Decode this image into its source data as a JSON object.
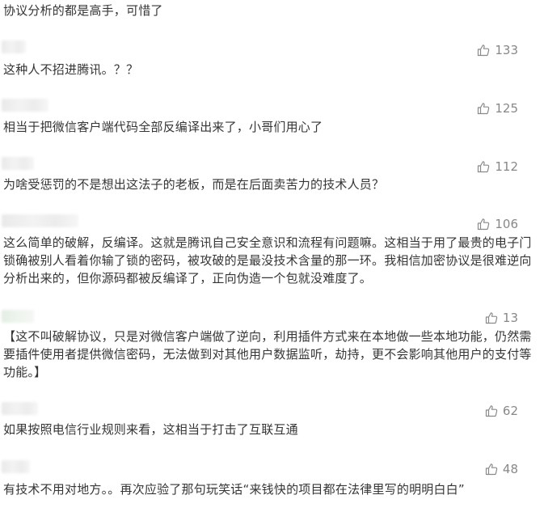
{
  "comments": [
    {
      "text": "协议分析的都是高手，可惜了",
      "likes": ""
    },
    {
      "text": "这种人不招进腾讯。？？",
      "likes": "133"
    },
    {
      "text": "相当于把微信客户端代码全部反编译出来了，小哥们用心了",
      "likes": "125"
    },
    {
      "text": "为啥受惩罚的不是想出这法子的老板，而是在后面卖苦力的技术人员？",
      "likes": "112"
    },
    {
      "text": "这么简单的破解，反编译。这就是腾讯自己安全意识和流程有问题嘛。这相当于用了最贵的电子门锁确被别人看着你输了锁的密码，被攻破的是最没技术含量的那一环。我相信加密协议是很难逆向分析出来的，但你源码都被反编译了，正向伪造一个包就没难度了。",
      "likes": "106"
    },
    {
      "text": "【这不叫破解协议，只是对微信客户端做了逆向，利用插件方式来在本地做一些本地功能，仍然需要插件使用者提供微信密码，无法做到对其他用户数据监听，劫持，更不会影响其他用户的支付等功能。】",
      "likes": "13"
    },
    {
      "text": "如果按照电信行业规则来看，这相当于打击了互联互通",
      "likes": "62"
    },
    {
      "text": "有技术不用对地方。。再次应验了那句玩笑话“来钱快的项目都在法律里写的明明白白”",
      "likes": "48"
    }
  ],
  "icons": {
    "like": "thumbs-up-icon"
  }
}
